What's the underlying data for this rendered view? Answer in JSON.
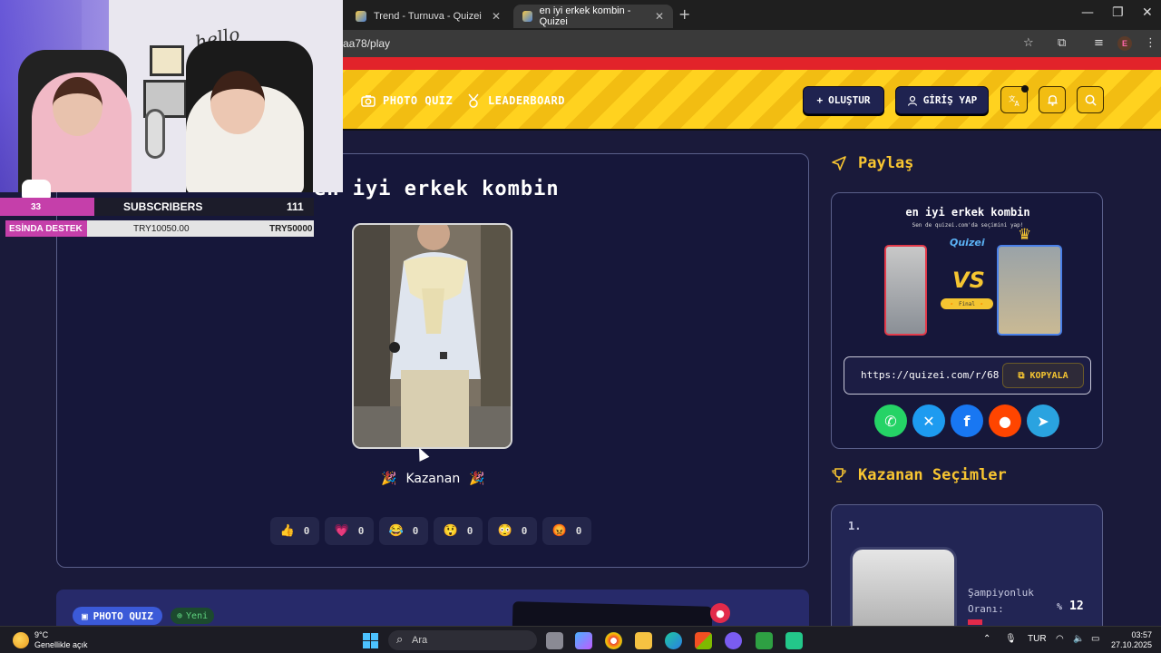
{
  "browser": {
    "tabs": [
      {
        "title": "Trend - Turnuva - Quizei"
      },
      {
        "title": "en iyi erkek kombin - Quizei"
      }
    ],
    "url": "aa78/play",
    "profile_initial": "E"
  },
  "nav": {
    "photo_quiz": "PHOTO QUIZ",
    "leaderboard": "LEADERBOARD",
    "create_label": "OLUŞTUR",
    "login_label": "GİRİŞ YAP"
  },
  "quiz": {
    "title": "en iyi erkek kombin",
    "winner_label": "Kazanan",
    "reactions": [
      {
        "emoji": "👍",
        "count": "0"
      },
      {
        "emoji": "💗",
        "count": "0"
      },
      {
        "emoji": "😂",
        "count": "0"
      },
      {
        "emoji": "😲",
        "count": "0"
      },
      {
        "emoji": "😳",
        "count": "0"
      },
      {
        "emoji": "😡",
        "count": "0"
      }
    ]
  },
  "bottom_card": {
    "badge": "PHOTO QUIZ",
    "new_badge": "Yeni"
  },
  "share": {
    "heading": "Paylaş",
    "preview_title": "en iyi erkek kombin",
    "preview_subtitle": "Sen de quizei.com'da seçimini yap!",
    "preview_brand": "Quizei",
    "preview_vs": "VS",
    "preview_final": "🔸 Final 🔸",
    "link": "https://quizei.com/r/68",
    "copy_label": "KOPYALA",
    "socials": [
      "whatsapp",
      "x",
      "facebook",
      "reddit",
      "telegram"
    ]
  },
  "winners": {
    "heading": "Kazanan Seçimler",
    "rank": "1.",
    "champ_label_1": "Şampiyonluk",
    "champ_label_2": "Oranı:",
    "champ_pct_sign": "%",
    "champ_value": "12",
    "champ_rate": 0.12
  },
  "overlay": {
    "hello_text": "hello",
    "subs_count": "33",
    "subs_label": "SUBSCRIBERS",
    "subs_value": "111",
    "donation_label": "ESİNDA DESTEK",
    "donation_current": "TRY10050.00",
    "donation_goal": "TRY50000"
  },
  "taskbar": {
    "temp": "9°C",
    "weather_desc": "Genellikle açık",
    "search_placeholder": "Ara",
    "lang": "TUR",
    "time": "03:57",
    "date": "27.10.2025"
  },
  "colors": {
    "accent_yellow": "#f8c531",
    "header_stripe_a": "#ffd21f",
    "header_stripe_b": "#f2bd12",
    "red_bar": "#e2232a",
    "page_bg": "#1a1a3a",
    "stream_pink": "#c53faa"
  }
}
